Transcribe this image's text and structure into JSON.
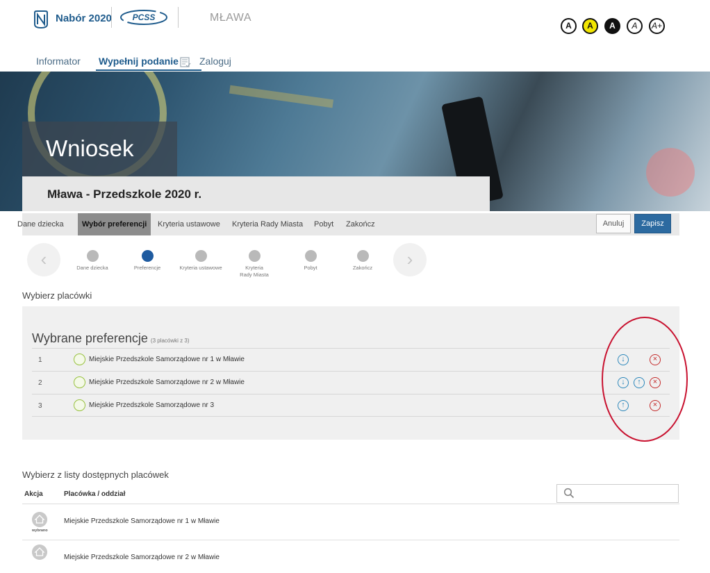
{
  "header": {
    "brand": "Nabór 2020",
    "partner_logo": "PCSS",
    "city": "MŁAWA",
    "contrast_buttons": [
      "A",
      "A",
      "A",
      "A",
      "A+"
    ]
  },
  "nav": {
    "items": [
      "Informator",
      "Wypełnij podanie",
      "Zaloguj"
    ],
    "active_index": 1
  },
  "hero": {
    "title": "Wniosek",
    "subtitle": "Mława - Przedszkole 2020 r."
  },
  "step_tabs": {
    "items": [
      "Dane dziecka",
      "Wybór preferencji",
      "Kryteria ustawowe",
      "Kryteria Rady Miasta",
      "Pobyt",
      "Zakończ"
    ],
    "active_index": 1,
    "cancel_label": "Anuluj",
    "save_label": "Zapisz"
  },
  "wizard": {
    "steps": [
      "Dane dziecka",
      "Preferencje",
      "Kryteria ustawowe",
      "Kryteria Rady Miasta",
      "Pobyt",
      "Zakończ"
    ],
    "current_index": 1
  },
  "select_section": {
    "title": "Wybierz placówki"
  },
  "preferences": {
    "heading": "Wybrane preferencje",
    "count": "(3 placówki z 3)",
    "items": [
      {
        "num": "1",
        "name": "Miejskie Przedszkole Samorządowe nr 1 w Mławie",
        "actions": [
          "down",
          "delete"
        ]
      },
      {
        "num": "2",
        "name": "Miejskie Przedszkole Samorządowe nr 2 w Mławie",
        "actions": [
          "down",
          "up",
          "delete"
        ]
      },
      {
        "num": "3",
        "name": "Miejskie Przedszkole Samorządowe nr 3",
        "actions": [
          "up",
          "delete"
        ]
      }
    ],
    "icons": {
      "down": "arrow-down-circle-icon",
      "up": "arrow-up-circle-icon",
      "delete": "close-circle-icon"
    },
    "colors": {
      "move": "#2a86ba",
      "delete": "#c42a2a",
      "highlight": "#c8102e"
    }
  },
  "available": {
    "title": "Wybierz z listy dostępnych placówek",
    "col_action": "Akcja",
    "col_name": "Placówka / oddział",
    "search_placeholder": "",
    "rows": [
      {
        "name": "Miejskie Przedszkole Samorządowe nr 1 w Mławie",
        "tag": "wybrano"
      },
      {
        "name": "Miejskie Przedszkole Samorządowe nr 2 w Mławie",
        "tag": ""
      }
    ]
  }
}
